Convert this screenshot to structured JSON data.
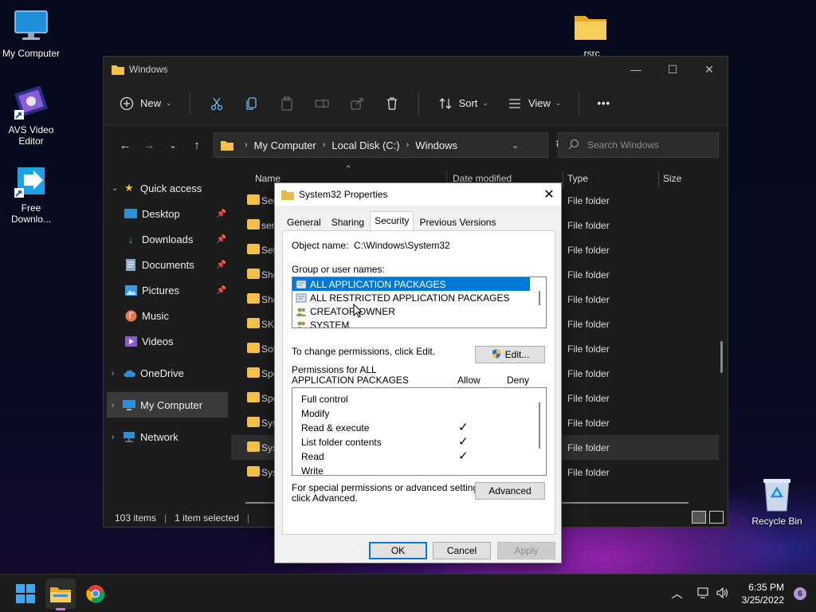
{
  "desktop": {
    "icons": {
      "my_computer": "My Computer",
      "avs_line1": "AVS Video",
      "avs_line2": "Editor",
      "free_line1": "Free",
      "free_line2": "Downlo...",
      "rsrc": ".rsrc",
      "recycle": "Recycle Bin"
    }
  },
  "explorer": {
    "title": "Windows",
    "toolbar": {
      "new_label": "New",
      "sort_label": "Sort",
      "view_label": "View",
      "more_label": "•••"
    },
    "breadcrumb": [
      "My Computer",
      "Local Disk (C:)",
      "Windows"
    ],
    "search_placeholder": "Search Windows",
    "nav": {
      "quick_access": "Quick access",
      "desktop": "Desktop",
      "downloads": "Downloads",
      "documents": "Documents",
      "pictures": "Pictures",
      "music": "Music",
      "videos": "Videos",
      "onedrive": "OneDrive",
      "my_computer": "My Computer",
      "network": "Network"
    },
    "columns": {
      "name": "Name",
      "date": "Date modified",
      "type": "Type",
      "size": "Size"
    },
    "rows": [
      {
        "name": "Ser",
        "type": "File folder"
      },
      {
        "name": "ser",
        "type": "File folder"
      },
      {
        "name": "Set",
        "type": "File folder"
      },
      {
        "name": "She",
        "type": "File folder"
      },
      {
        "name": "She",
        "type": "File folder"
      },
      {
        "name": "SKB",
        "type": "File folder"
      },
      {
        "name": "Sof",
        "type": "File folder"
      },
      {
        "name": "Spe",
        "type": "File folder"
      },
      {
        "name": "Spe",
        "type": "File folder"
      },
      {
        "name": "Sys",
        "type": "File folder"
      },
      {
        "name": "Sys",
        "type": "File folder"
      },
      {
        "name": "Sys",
        "type": "File folder"
      }
    ],
    "status": {
      "items": "103 items",
      "sep": "|",
      "selected": "1 item selected",
      "sep2": "|"
    }
  },
  "dialog": {
    "title": "System32 Properties",
    "tabs": [
      "General",
      "Sharing",
      "Security",
      "Previous Versions"
    ],
    "object_name_label": "Object name:",
    "object_name_value": "C:\\Windows\\System32",
    "group_label": "Group or user names:",
    "groups": [
      "ALL APPLICATION PACKAGES",
      "ALL RESTRICTED APPLICATION PACKAGES",
      "CREATOR OWNER",
      "SYSTEM"
    ],
    "change_text": "To change permissions, click Edit.",
    "edit_label": "Edit...",
    "perm_for_line1": "Permissions for ALL",
    "perm_for_line2": "APPLICATION PACKAGES",
    "allow_label": "Allow",
    "deny_label": "Deny",
    "permissions": [
      {
        "name": "Full control",
        "allow": ""
      },
      {
        "name": "Modify",
        "allow": ""
      },
      {
        "name": "Read & execute",
        "allow": "✓"
      },
      {
        "name": "List folder contents",
        "allow": "✓"
      },
      {
        "name": "Read",
        "allow": "✓"
      },
      {
        "name": "Write",
        "allow": ""
      }
    ],
    "special_line1": "For special permissions or advanced settings,",
    "special_line2": "click Advanced.",
    "advanced_label": "Advanced",
    "ok_label": "OK",
    "cancel_label": "Cancel",
    "apply_label": "Apply"
  },
  "taskbar": {
    "time": "6:35 PM",
    "date": "3/25/2022",
    "notifications": "6"
  }
}
